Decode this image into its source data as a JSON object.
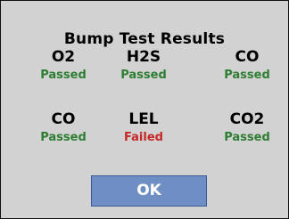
{
  "dialog": {
    "title": "Bump Test Results",
    "results": [
      {
        "gas": "O2",
        "status": "Passed",
        "state": "pass"
      },
      {
        "gas": "H2S",
        "status": "Passed",
        "state": "pass"
      },
      {
        "gas": "CO",
        "status": "Passed",
        "state": "pass"
      },
      {
        "gas": "CO",
        "status": "Passed",
        "state": "pass"
      },
      {
        "gas": "LEL",
        "status": "Failed",
        "state": "fail"
      },
      {
        "gas": "CO2",
        "status": "Passed",
        "state": "pass"
      }
    ],
    "ok_label": "OK"
  },
  "colors": {
    "background": "#d2d2d2",
    "passed": "#2e7d32",
    "failed": "#c62828",
    "button": "#6f8fc4"
  }
}
